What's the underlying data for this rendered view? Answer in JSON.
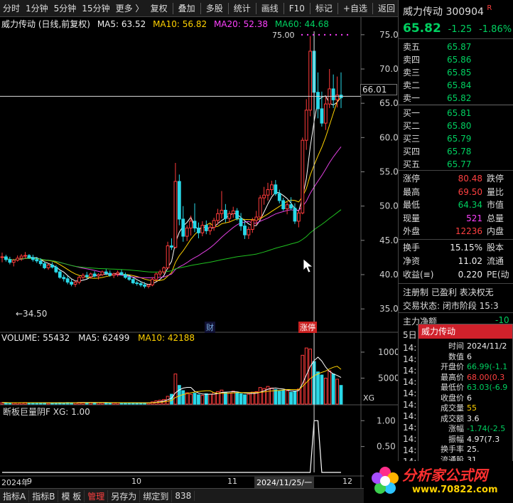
{
  "toolbar": {
    "left": [
      "分时",
      "1分钟",
      "5分钟",
      "15分钟",
      "更多 〉"
    ],
    "right": [
      "复权",
      "叠加",
      "多股",
      "统计",
      "画线",
      "F10",
      "标记",
      "+自选",
      "返回"
    ]
  },
  "legend": {
    "name": "威力传动 (日线,前复权)",
    "ma5": "MA5: 63.52",
    "ma10": "MA10: 56.82",
    "ma20": "MA20: 52.38",
    "ma60": "MA60: 44.68"
  },
  "chart_labels": {
    "high_marker": "75.00",
    "low_marker": "←34.50",
    "cursor_price": "66.01",
    "event_cai": "财",
    "event_zhangting": "涨停"
  },
  "chart_data": {
    "type": "candlestick",
    "price_axis_ticks": [
      75,
      70,
      65,
      60,
      55,
      50,
      45,
      40,
      35
    ],
    "volume_axis_ticks": [
      10000,
      5000
    ],
    "indicator_axis_ticks": [
      1.0,
      0.5
    ],
    "x_labels": [
      "2024年",
      "9",
      "10",
      "11",
      "2024/11/25/一",
      "12"
    ],
    "colors": {
      "up": "#ff3b3b",
      "down": "#29d8e8",
      "ma5": "#ffffff",
      "ma10": "#ffd200",
      "ma20": "#e040e0",
      "ma60": "#20c020"
    },
    "candles": [
      [
        42.5,
        43.2,
        41.8,
        42.6
      ],
      [
        42.6,
        42.9,
        41.9,
        42.2
      ],
      [
        42.2,
        42.6,
        41.5,
        41.8
      ],
      [
        41.8,
        42.3,
        41.2,
        42.1
      ],
      [
        42.1,
        42.8,
        41.9,
        42.4
      ],
      [
        42.4,
        43.0,
        42.0,
        42.7
      ],
      [
        42.7,
        43.3,
        42.3,
        42.8
      ],
      [
        42.8,
        43.0,
        42.3,
        42.5
      ],
      [
        42.5,
        42.9,
        41.9,
        42.2
      ],
      [
        42.2,
        42.6,
        41.7,
        42.0
      ],
      [
        42.0,
        42.4,
        41.3,
        41.6
      ],
      [
        41.6,
        41.9,
        40.8,
        41.0
      ],
      [
        41.0,
        41.6,
        40.7,
        41.4
      ],
      [
        41.4,
        41.8,
        40.9,
        41.1
      ],
      [
        41.1,
        41.4,
        40.2,
        40.4
      ],
      [
        40.4,
        40.7,
        39.4,
        39.6
      ],
      [
        39.6,
        40.0,
        39.0,
        39.4
      ],
      [
        39.4,
        39.8,
        38.6,
        38.9
      ],
      [
        38.9,
        39.3,
        38.3,
        38.6
      ],
      [
        38.6,
        39.1,
        38.2,
        38.9
      ],
      [
        38.9,
        39.8,
        38.6,
        39.6
      ],
      [
        39.6,
        40.2,
        39.3,
        39.9
      ],
      [
        39.9,
        40.4,
        39.4,
        39.7
      ],
      [
        39.7,
        40.3,
        39.4,
        40.1
      ],
      [
        40.1,
        40.5,
        39.6,
        39.8
      ],
      [
        39.8,
        40.2,
        39.3,
        40.0
      ],
      [
        40.0,
        40.6,
        39.8,
        40.4
      ],
      [
        40.4,
        40.8,
        39.9,
        40.2
      ],
      [
        40.2,
        40.6,
        39.7,
        39.9
      ],
      [
        39.9,
        40.3,
        39.5,
        40.1
      ],
      [
        40.1,
        40.6,
        39.7,
        40.3
      ],
      [
        40.3,
        40.7,
        39.9,
        40.0
      ],
      [
        40.0,
        40.3,
        39.4,
        39.6
      ],
      [
        39.6,
        40.0,
        39.1,
        39.3
      ],
      [
        39.3,
        39.6,
        38.6,
        38.8
      ],
      [
        38.8,
        39.1,
        38.4,
        38.7
      ],
      [
        38.7,
        39.0,
        38.2,
        38.5
      ],
      [
        38.5,
        38.9,
        38.0,
        38.3
      ],
      [
        38.3,
        38.6,
        38.0,
        38.5
      ],
      [
        38.5,
        39.6,
        38.3,
        39.3
      ],
      [
        39.3,
        40.3,
        39.0,
        40.1
      ],
      [
        40.1,
        40.7,
        39.7,
        40.4
      ],
      [
        40.4,
        41.2,
        40.1,
        41.0
      ],
      [
        41.0,
        44.8,
        40.8,
        44.2
      ],
      [
        44.2,
        45.3,
        43.6,
        44.0
      ],
      [
        44.0,
        56.3,
        43.8,
        53.6
      ],
      [
        53.6,
        54.6,
        47.2,
        48.1
      ],
      [
        48.1,
        50.0,
        44.8,
        45.6
      ],
      [
        45.6,
        47.2,
        44.9,
        46.8
      ],
      [
        46.8,
        48.6,
        45.7,
        47.8
      ],
      [
        47.8,
        50.4,
        46.2,
        46.8
      ],
      [
        46.8,
        47.6,
        45.3,
        46.1
      ],
      [
        46.1,
        47.8,
        45.6,
        47.2
      ],
      [
        47.2,
        47.9,
        45.9,
        46.4
      ],
      [
        46.4,
        47.4,
        45.8,
        46.9
      ],
      [
        46.9,
        48.3,
        46.4,
        47.9
      ],
      [
        47.9,
        49.6,
        47.3,
        48.9
      ],
      [
        48.9,
        52.2,
        48.2,
        49.4
      ],
      [
        49.4,
        50.3,
        47.6,
        48.2
      ],
      [
        48.2,
        49.3,
        47.6,
        48.9
      ],
      [
        48.9,
        49.9,
        48.3,
        49.3
      ],
      [
        49.3,
        49.7,
        47.9,
        48.2
      ],
      [
        48.2,
        49.0,
        46.4,
        47.1
      ],
      [
        47.1,
        47.8,
        45.2,
        45.8
      ],
      [
        45.8,
        47.0,
        45.2,
        46.6
      ],
      [
        46.6,
        48.3,
        46.1,
        47.9
      ],
      [
        47.9,
        49.3,
        47.2,
        48.4
      ],
      [
        48.4,
        51.6,
        48.0,
        51.2
      ],
      [
        51.2,
        52.8,
        50.2,
        51.6
      ],
      [
        51.6,
        53.4,
        50.8,
        52.4
      ],
      [
        52.4,
        53.7,
        51.6,
        53.1
      ],
      [
        53.1,
        53.8,
        51.5,
        51.8
      ],
      [
        51.8,
        52.4,
        50.4,
        50.8
      ],
      [
        50.8,
        51.2,
        49.3,
        49.6
      ],
      [
        49.6,
        50.6,
        48.8,
        50.2
      ],
      [
        50.2,
        51.3,
        49.4,
        49.7
      ],
      [
        49.7,
        50.4,
        47.4,
        47.8
      ],
      [
        47.8,
        49.4,
        46.9,
        49.0
      ],
      [
        49.0,
        60.0,
        48.8,
        59.6
      ],
      [
        59.6,
        65.6,
        58.2,
        64.0
      ],
      [
        64.0,
        74.8,
        63.1,
        72.6
      ],
      [
        72.6,
        75.0,
        63.4,
        66.6
      ],
      [
        66.6,
        69.5,
        62.8,
        64.2
      ],
      [
        64.2,
        66.7,
        61.6,
        62.1
      ],
      [
        62.1,
        66.0,
        61.1,
        64.9
      ],
      [
        64.9,
        70.0,
        64.3,
        67.1
      ],
      [
        67.1,
        69.2,
        64.3,
        65.5
      ],
      [
        65.5,
        68.9,
        64.4,
        66.2
      ],
      [
        66.2,
        69.5,
        64.3,
        65.8
      ]
    ],
    "volumes": [
      [
        300,
        0
      ],
      [
        280,
        1
      ],
      [
        260,
        1
      ],
      [
        250,
        0
      ],
      [
        270,
        0
      ],
      [
        290,
        0
      ],
      [
        310,
        0
      ],
      [
        270,
        1
      ],
      [
        260,
        1
      ],
      [
        240,
        1
      ],
      [
        250,
        1
      ],
      [
        260,
        1
      ],
      [
        230,
        0
      ],
      [
        220,
        1
      ],
      [
        240,
        1
      ],
      [
        280,
        1
      ],
      [
        260,
        1
      ],
      [
        300,
        1
      ],
      [
        280,
        1
      ],
      [
        270,
        0
      ],
      [
        320,
        0
      ],
      [
        340,
        0
      ],
      [
        290,
        1
      ],
      [
        310,
        0
      ],
      [
        280,
        1
      ],
      [
        270,
        0
      ],
      [
        300,
        0
      ],
      [
        290,
        1
      ],
      [
        260,
        1
      ],
      [
        250,
        0
      ],
      [
        270,
        0
      ],
      [
        260,
        1
      ],
      [
        240,
        1
      ],
      [
        250,
        1
      ],
      [
        260,
        1
      ],
      [
        230,
        1
      ],
      [
        240,
        1
      ],
      [
        250,
        1
      ],
      [
        260,
        0
      ],
      [
        420,
        0
      ],
      [
        640,
        0
      ],
      [
        760,
        0
      ],
      [
        900,
        0
      ],
      [
        1500,
        0
      ],
      [
        1900,
        1
      ],
      [
        5800,
        0
      ],
      [
        3600,
        1
      ],
      [
        2600,
        1
      ],
      [
        2200,
        0
      ],
      [
        1900,
        0
      ],
      [
        2100,
        1
      ],
      [
        1800,
        1
      ],
      [
        1700,
        0
      ],
      [
        2000,
        1
      ],
      [
        1900,
        0
      ],
      [
        2200,
        0
      ],
      [
        2400,
        0
      ],
      [
        2700,
        0
      ],
      [
        2300,
        1
      ],
      [
        2100,
        0
      ],
      [
        2500,
        0
      ],
      [
        2200,
        1
      ],
      [
        2000,
        1
      ],
      [
        1800,
        1
      ],
      [
        1900,
        0
      ],
      [
        2300,
        0
      ],
      [
        2400,
        0
      ],
      [
        3200,
        0
      ],
      [
        3000,
        0
      ],
      [
        3400,
        0
      ],
      [
        3100,
        0
      ],
      [
        2800,
        1
      ],
      [
        2500,
        1
      ],
      [
        2700,
        1
      ],
      [
        2600,
        0
      ],
      [
        2300,
        1
      ],
      [
        2500,
        1
      ],
      [
        2900,
        0
      ],
      [
        9400,
        0
      ],
      [
        10800,
        0
      ],
      [
        10600,
        0
      ],
      [
        8200,
        1
      ],
      [
        6200,
        1
      ],
      [
        5600,
        1
      ],
      [
        5000,
        0
      ],
      [
        6400,
        0
      ],
      [
        5800,
        1
      ],
      [
        4800,
        0
      ],
      [
        3600,
        1
      ]
    ]
  },
  "volume_legend": {
    "volume": "VOLUME: 55432",
    "ma5": "MA5: 62499",
    "ma10": "MA10: 42188"
  },
  "volume_xg_label": "XG",
  "indicator_legend": "断板巨量阴F  XG: 1.00",
  "date_axis": [
    "2024年",
    "9",
    "10",
    "11",
    "2024/11/25/一",
    "12"
  ],
  "bottom_tabs": [
    "指标A",
    "指标B",
    "模 板",
    "管理",
    "另存为",
    "绑定到",
    "838"
  ],
  "quote": {
    "title": "威力传动",
    "code": "300904",
    "badge": "R",
    "price": "65.82",
    "change": "-1.25",
    "change_pct": "-1.86%",
    "asks": [
      {
        "label": "卖五",
        "price": "65.87"
      },
      {
        "label": "卖四",
        "price": "65.86"
      },
      {
        "label": "卖三",
        "price": "65.85"
      },
      {
        "label": "卖二",
        "price": "65.84"
      },
      {
        "label": "卖一",
        "price": "65.82"
      }
    ],
    "bids": [
      {
        "label": "买一",
        "price": "65.81"
      },
      {
        "label": "买二",
        "price": "65.80"
      },
      {
        "label": "买三",
        "price": "65.79"
      },
      {
        "label": "买四",
        "price": "65.78"
      },
      {
        "label": "买五",
        "price": "65.77"
      }
    ],
    "stats": [
      {
        "label": "涨停",
        "value": "80.48",
        "label2": "跌停"
      },
      {
        "label": "最高",
        "value": "69.50",
        "label2": "量比"
      },
      {
        "label": "最低",
        "value": "64.34",
        "label2": "市值"
      },
      {
        "label": "现量",
        "value": "521",
        "label2": "总量"
      },
      {
        "label": "外盘",
        "value": "12236",
        "label2": "内盘"
      }
    ],
    "stats2": [
      {
        "label": "换手",
        "value": "15.15%",
        "label2": "股本"
      },
      {
        "label": "净资",
        "value": "11.02",
        "label2": "流通"
      },
      {
        "label": "收益(≡)",
        "value": "0.220",
        "label2": "PE(动"
      }
    ],
    "info1": "注册制  已盈利  表决权无",
    "info2": "交易状态: 闭市阶段  15:3",
    "net_flow_label": "主力净额",
    "net_flow_value": "-10",
    "five_day": "5日",
    "times": [
      "14:",
      "14:",
      "14:",
      "14:",
      "14:",
      "14:",
      "14:",
      "14:",
      "14:",
      "14:",
      "14:",
      "14:",
      "14:"
    ]
  },
  "popup": {
    "title": "威力传动",
    "rows": [
      {
        "label": "时间",
        "value": "2024/11/2"
      },
      {
        "label": "数值",
        "value": "6"
      },
      {
        "label": "开盘价",
        "value": "66.99(-1.1"
      },
      {
        "label": "最高价",
        "value": "68.00(0.3"
      },
      {
        "label": "最低价",
        "value": "63.03(-6.9"
      },
      {
        "label": "收盘价",
        "value": "6"
      },
      {
        "label": "成交量",
        "value": "55"
      },
      {
        "label": "成交额",
        "value": "3.6"
      },
      {
        "label": "涨幅",
        "value": "-1.74(-2.5"
      },
      {
        "label": "振幅",
        "value": "4.97(7.3"
      },
      {
        "label": "换手率",
        "value": "25."
      },
      {
        "label": "流通股",
        "value": "31"
      }
    ]
  },
  "logo": {
    "text": "分析家公式网",
    "url": "www.70822.com"
  }
}
